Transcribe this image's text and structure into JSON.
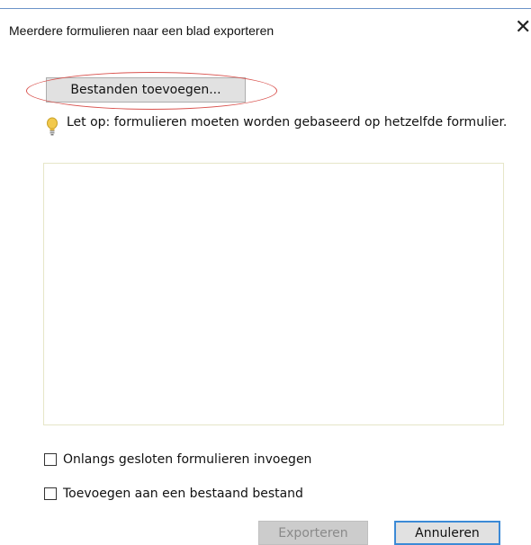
{
  "dialog": {
    "title": "Meerdere formulieren naar een blad exporteren",
    "close_label": "✕"
  },
  "add_files_button": {
    "label": "Bestanden toevoegen..."
  },
  "notice": {
    "icon": "lightbulb-icon",
    "text": "Let op: formulieren moeten worden gebaseerd op hetzelfde formulier."
  },
  "file_list": {
    "items": []
  },
  "options": {
    "insert_recent": {
      "label": "Onlangs gesloten formulieren invoegen",
      "checked": false
    },
    "append_existing": {
      "label": "Toevoegen aan een bestaand bestand",
      "checked": false
    }
  },
  "buttons": {
    "export": {
      "label": "Exporteren",
      "enabled": false
    },
    "cancel": {
      "label": "Annuleren",
      "enabled": true
    }
  },
  "colors": {
    "highlight_oval": "#d9534f",
    "focus_border": "#3c8ad6",
    "title_accent_line": "#6b93c8"
  }
}
